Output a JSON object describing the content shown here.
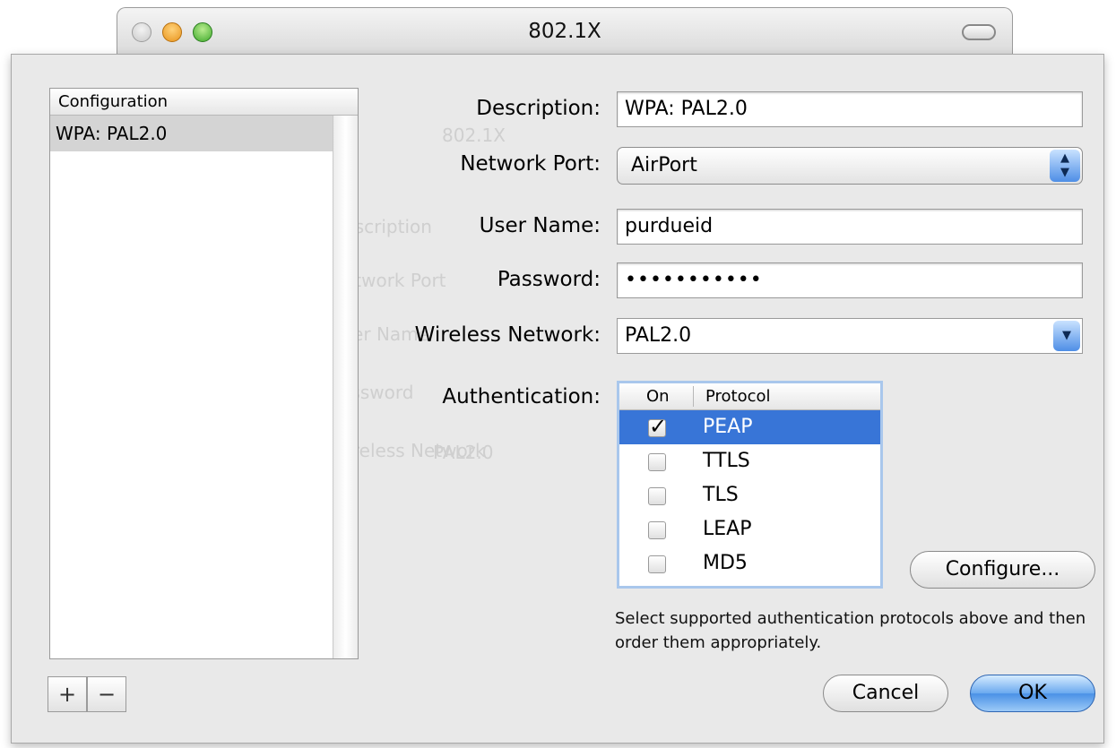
{
  "window": {
    "title": "802.1X"
  },
  "background_ghost": [
    "Description",
    "Network Port",
    "User Name",
    "Password",
    "Wireless Network",
    "PAL2.0",
    "802.1X"
  ],
  "sidebar": {
    "header": "Configuration",
    "items": [
      {
        "label": "WPA: PAL2.0",
        "selected": true
      }
    ],
    "add_label": "+",
    "remove_label": "−"
  },
  "form": {
    "description": {
      "label": "Description:",
      "value": "WPA: PAL2.0"
    },
    "network_port": {
      "label": "Network Port:",
      "value": "AirPort"
    },
    "user_name": {
      "label": "User Name:",
      "value": "purdueid"
    },
    "password": {
      "label": "Password:",
      "value": "•••••••••••"
    },
    "wireless_network": {
      "label": "Wireless Network:",
      "value": "PAL2.0"
    },
    "authentication": {
      "label": "Authentication:"
    }
  },
  "protocols": {
    "columns": [
      "On",
      "Protocol"
    ],
    "rows": [
      {
        "name": "PEAP",
        "on": true,
        "selected": true
      },
      {
        "name": "TTLS",
        "on": false,
        "selected": false
      },
      {
        "name": "TLS",
        "on": false,
        "selected": false
      },
      {
        "name": "LEAP",
        "on": false,
        "selected": false
      },
      {
        "name": "MD5",
        "on": false,
        "selected": false
      }
    ]
  },
  "buttons": {
    "configure": "Configure...",
    "cancel": "Cancel",
    "ok": "OK"
  },
  "hint": "Select supported authentication protocols above and then order them appropriately.",
  "colors": {
    "selection": "#3875d7",
    "default_button": "#4a91e6"
  }
}
